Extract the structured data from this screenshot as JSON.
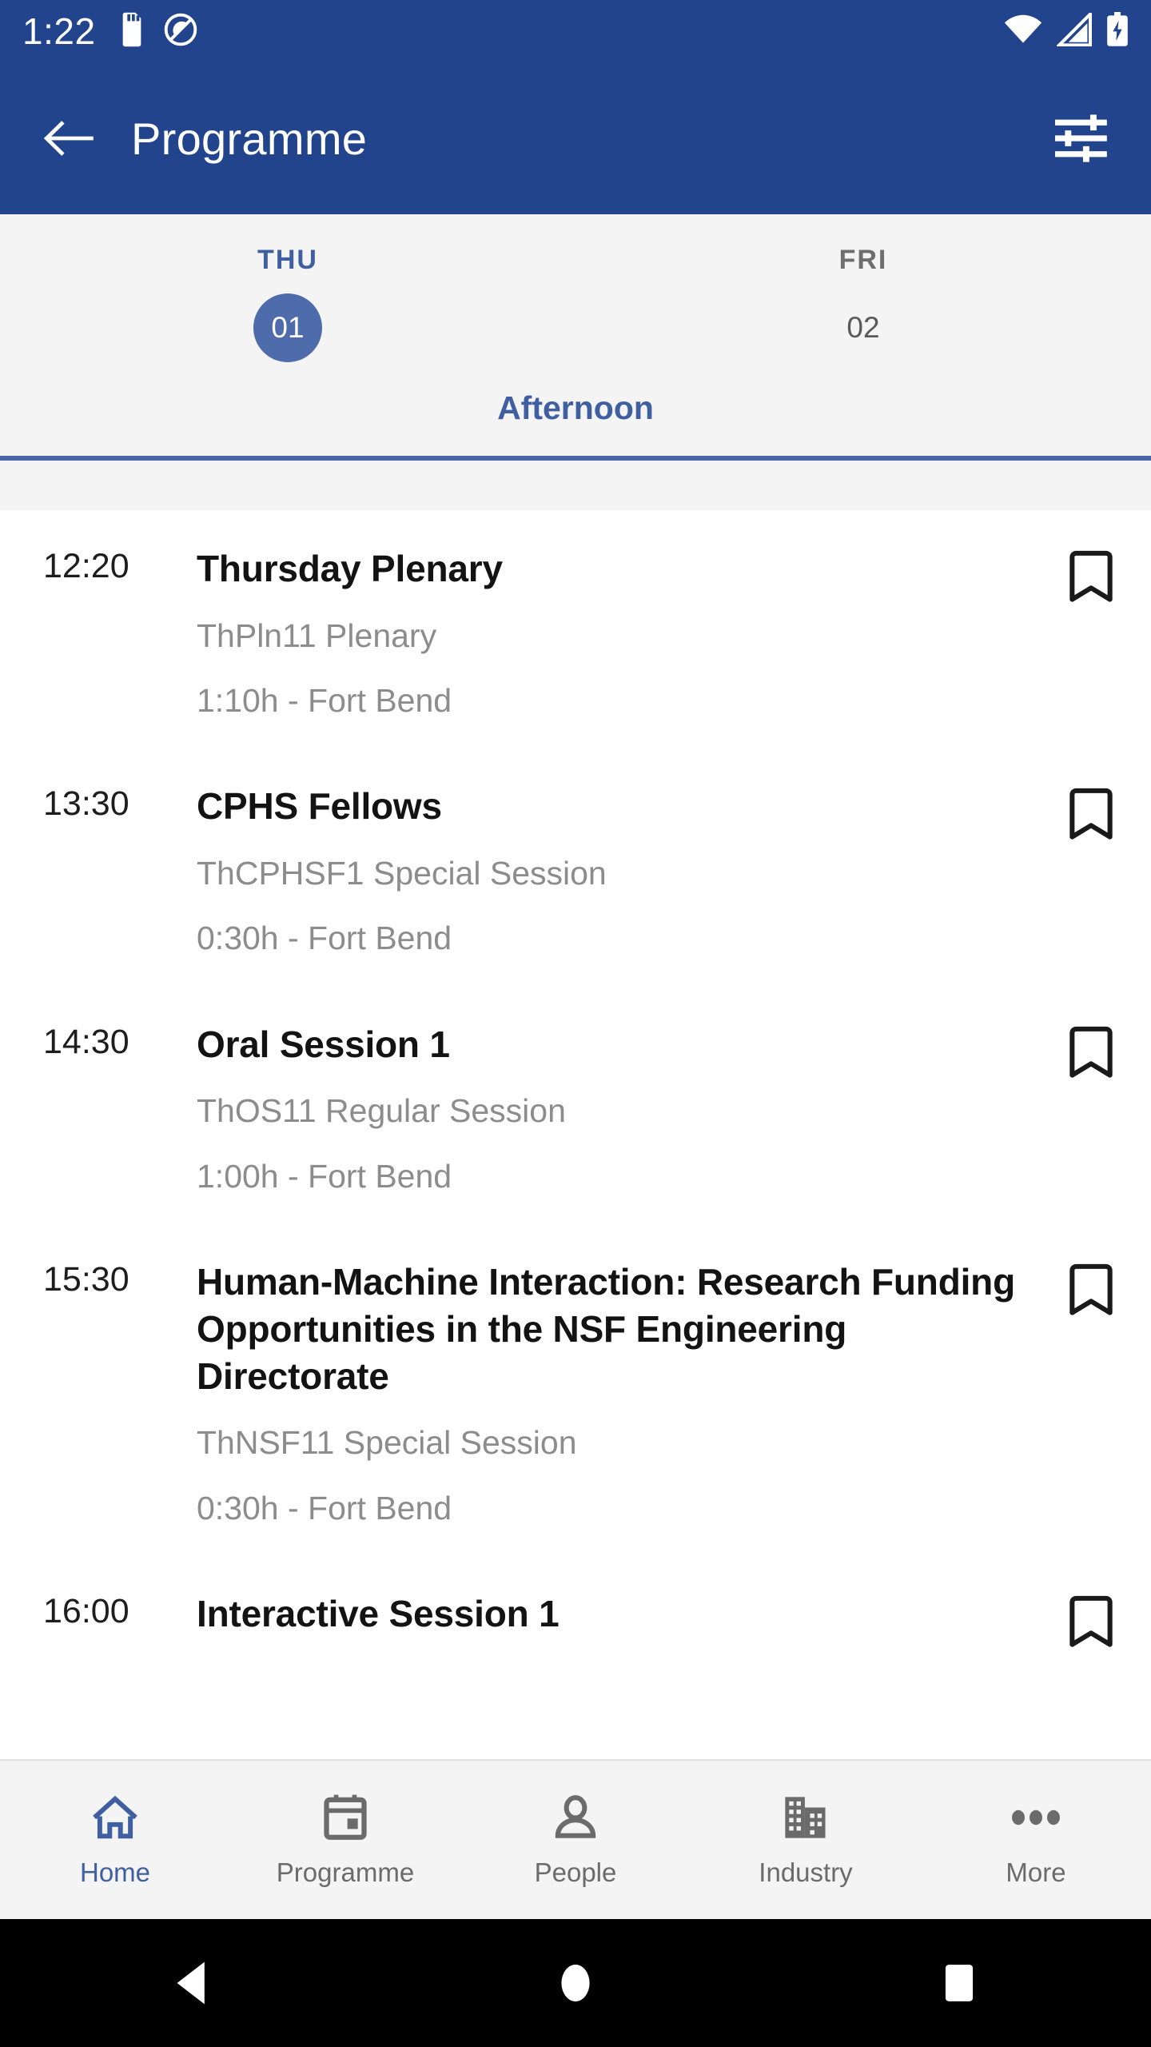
{
  "statusbar": {
    "time": "1:22",
    "icons": [
      "sd-card-icon",
      "do-not-disturb-icon",
      "wifi-icon",
      "cellular-signal-icon",
      "battery-charging-icon"
    ]
  },
  "appbar": {
    "back_icon": "back-arrow-icon",
    "title": "Programme",
    "filter_icon": "tune-filter-icon",
    "background": "#21448c"
  },
  "daystrip": {
    "background": "#f4f4f4",
    "accent": "#4e6bab",
    "days": [
      {
        "name": "THU",
        "number": "01",
        "selected": true
      },
      {
        "name": "FRI",
        "number": "02",
        "selected": false
      }
    ],
    "period": "Afternoon",
    "period_color": "#3f5fa0"
  },
  "sessions": [
    {
      "time": "12:20",
      "title": "Thursday Plenary",
      "code": "ThPln11 Plenary",
      "meta": "1:10h - Fort Bend",
      "bookmark_icon": "bookmark-outline-icon"
    },
    {
      "time": "13:30",
      "title": "CPHS Fellows",
      "code": "ThCPHSF1 Special Session",
      "meta": "0:30h - Fort Bend",
      "bookmark_icon": "bookmark-outline-icon"
    },
    {
      "time": "14:30",
      "title": "Oral Session 1",
      "code": "ThOS11 Regular Session",
      "meta": "1:00h - Fort Bend",
      "bookmark_icon": "bookmark-outline-icon"
    },
    {
      "time": "15:30",
      "title": "Human-Machine Interaction: Research Funding Opportunities in the NSF Engineering Directorate",
      "code": "ThNSF11 Special Session",
      "meta": "0:30h - Fort Bend",
      "bookmark_icon": "bookmark-outline-icon"
    },
    {
      "time": "16:00",
      "title": "Interactive Session 1",
      "code": "",
      "meta": "",
      "bookmark_icon": "bookmark-outline-icon"
    }
  ],
  "bottomnav": {
    "active_color": "#3f5fa0",
    "inactive_color": "#6b6b6b",
    "items": [
      {
        "label": "Home",
        "icon": "home-icon",
        "active": true
      },
      {
        "label": "Programme",
        "icon": "calendar-icon",
        "active": false
      },
      {
        "label": "People",
        "icon": "person-icon",
        "active": false
      },
      {
        "label": "Industry",
        "icon": "building-icon",
        "active": false
      },
      {
        "label": "More",
        "icon": "more-dots-icon",
        "active": false
      }
    ]
  },
  "sysnav": {
    "buttons": [
      {
        "icon": "android-back-icon"
      },
      {
        "icon": "android-home-icon"
      },
      {
        "icon": "android-recents-icon"
      }
    ]
  }
}
